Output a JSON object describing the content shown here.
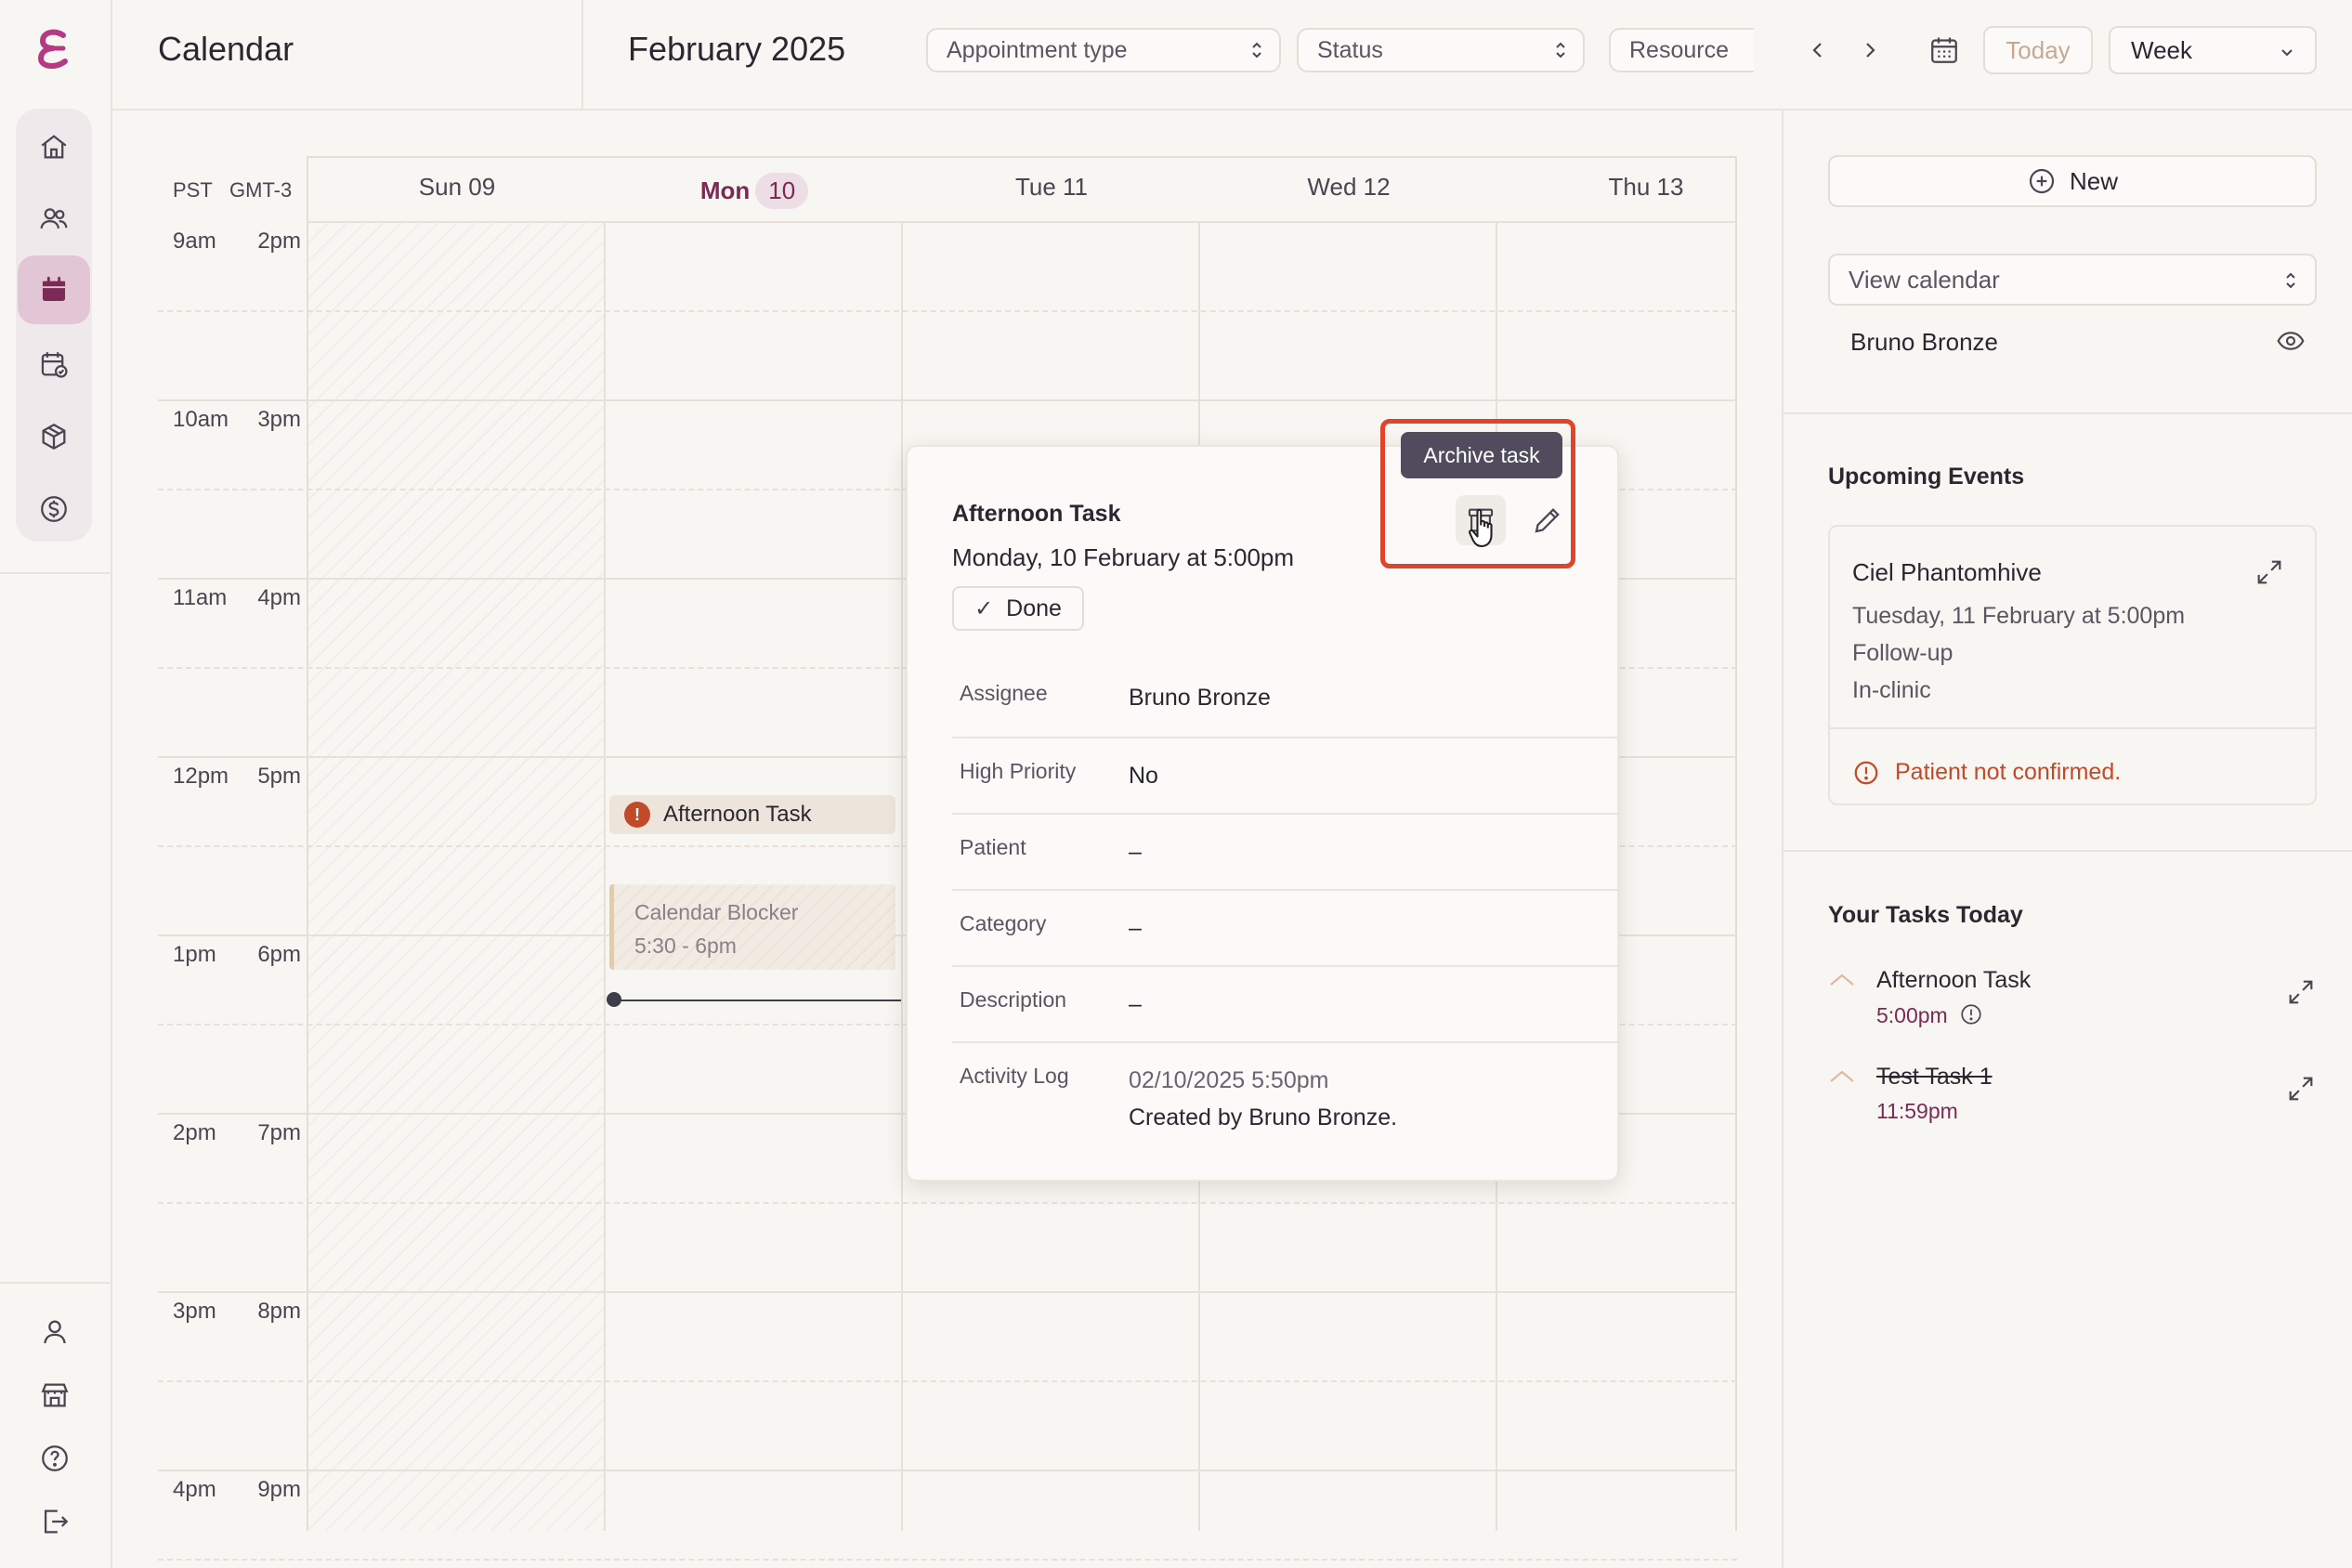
{
  "header": {
    "app_title": "Calendar",
    "month": "February 2025",
    "filters": {
      "appointment_type": "Appointment type",
      "status": "Status",
      "resource": "Resource"
    },
    "today_label": "Today",
    "view_label": "Week"
  },
  "calendar": {
    "timezones": [
      "PST",
      "GMT-3"
    ],
    "days": [
      {
        "label": "Sun 09"
      },
      {
        "label": "Mon",
        "num": "10"
      },
      {
        "label": "Tue 11"
      },
      {
        "label": "Wed 12"
      },
      {
        "label": "Thu 13"
      }
    ],
    "time_rows": [
      {
        "pst": "9am",
        "gmt": "2pm"
      },
      {
        "pst": "10am",
        "gmt": "3pm"
      },
      {
        "pst": "11am",
        "gmt": "4pm"
      },
      {
        "pst": "12pm",
        "gmt": "5pm"
      },
      {
        "pst": "1pm",
        "gmt": "6pm"
      },
      {
        "pst": "2pm",
        "gmt": "7pm"
      },
      {
        "pst": "3pm",
        "gmt": "8pm"
      },
      {
        "pst": "4pm",
        "gmt": "9pm"
      }
    ],
    "events": {
      "task_title": "Afternoon Task",
      "task_alert": "!",
      "blocker_title": "Calendar Blocker",
      "blocker_time": "5:30 - 6pm"
    }
  },
  "popover": {
    "title": "Afternoon Task",
    "date": "Monday, 10 February at 5:00pm",
    "done_label": "Done",
    "tooltip": "Archive task",
    "rows": [
      {
        "key": "Assignee",
        "value": "Bruno Bronze"
      },
      {
        "key": "High Priority",
        "value": "No"
      },
      {
        "key": "Patient",
        "value": "–"
      },
      {
        "key": "Category",
        "value": "–"
      },
      {
        "key": "Description",
        "value": "–"
      },
      {
        "key": "Activity Log",
        "value": "02/10/2025 5:50pm",
        "value2": "Created by Bruno Bronze."
      }
    ]
  },
  "right_panel": {
    "new_label": "New",
    "view_calendar": "View calendar",
    "calendar_person": "Bruno Bronze",
    "upcoming_title": "Upcoming Events",
    "upcoming": {
      "name": "Ciel Phantomhive",
      "date": "Tuesday, 11 February at 5:00pm",
      "type": "Follow-up",
      "location": "In-clinic",
      "warning": "Patient not confirmed."
    },
    "tasks_title": "Your Tasks Today",
    "tasks": [
      {
        "name": "Afternoon Task",
        "time": "5:00pm"
      },
      {
        "name": "Test Task 1",
        "time": "11:59pm"
      }
    ]
  },
  "colors": {
    "accent": "#7a2a55",
    "active_nav": "#e2c6d6",
    "warning": "#c24a2a",
    "highlight": "#e0442a",
    "tooltip_bg": "#514b5e",
    "background": "#f8f6f2"
  },
  "icons": {
    "nav": [
      "home-icon",
      "patients-icon",
      "calendar-icon",
      "schedule-check-icon",
      "inventory-icon",
      "billing-icon"
    ],
    "footer": [
      "profile-icon",
      "clinic-icon",
      "help-icon",
      "logout-icon"
    ]
  }
}
